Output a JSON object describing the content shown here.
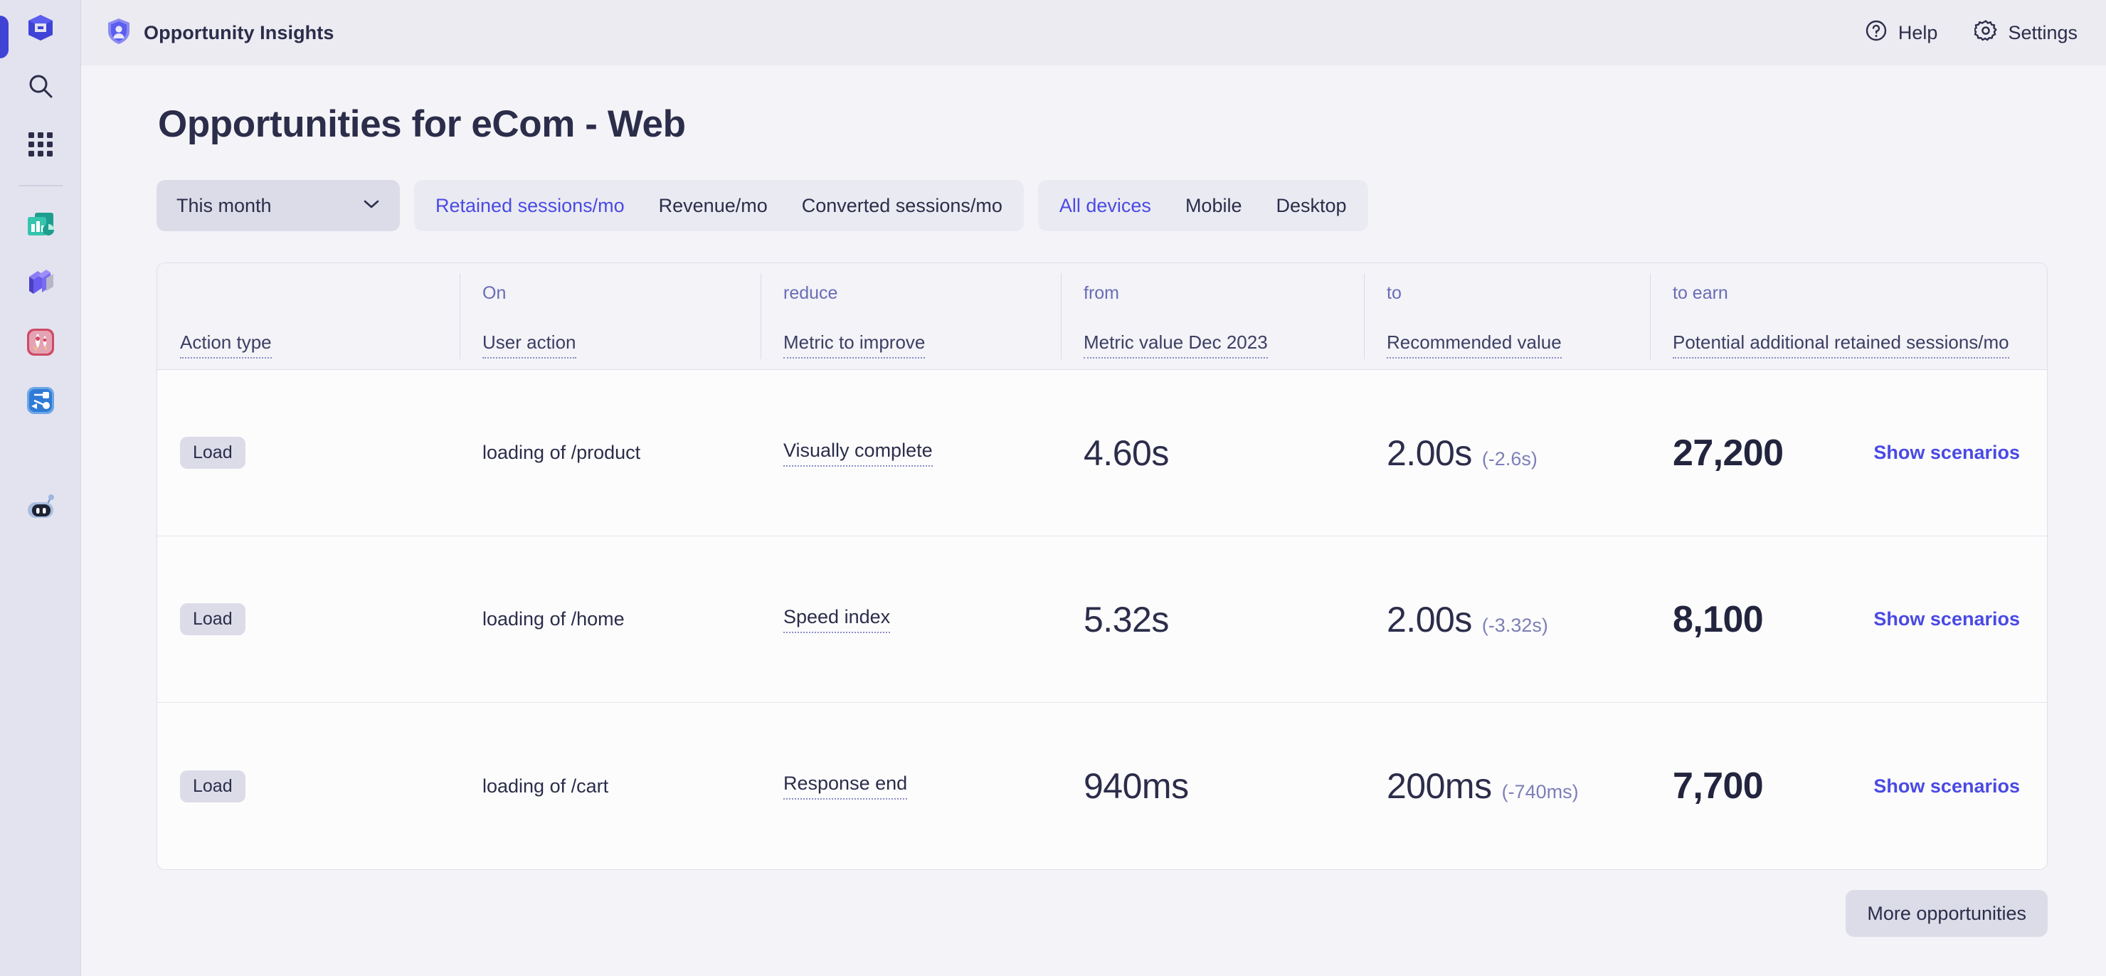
{
  "sidebar": {
    "items": [
      {
        "name": "cube-logo-icon",
        "label": "Home"
      },
      {
        "name": "search-icon",
        "label": "Search"
      },
      {
        "name": "apps-grid-icon",
        "label": "Apps"
      },
      {
        "name": "analytics-chart-icon",
        "label": "Analytics"
      },
      {
        "name": "layers-books-icon",
        "label": "Library"
      },
      {
        "name": "rocket-icon",
        "label": "Launch"
      },
      {
        "name": "flow-diagram-icon",
        "label": "Flows"
      },
      {
        "name": "robot-bot-icon",
        "label": "Assistant"
      }
    ]
  },
  "topbar": {
    "product_icon": "shield-person-icon",
    "product_title": "Opportunity Insights",
    "help_label": "Help",
    "help_icon": "question-circle-icon",
    "settings_label": "Settings",
    "settings_icon": "gear-icon"
  },
  "page": {
    "title": "Opportunities for eCom - Web"
  },
  "filters": {
    "period": {
      "value": "This month",
      "chevron_icon": "chevron-down-icon"
    },
    "metric_tabs": [
      {
        "label": "Retained sessions/mo",
        "active": true
      },
      {
        "label": "Revenue/mo",
        "active": false
      },
      {
        "label": "Converted sessions/mo",
        "active": false
      }
    ],
    "device_tabs": [
      {
        "label": "All devices",
        "active": true
      },
      {
        "label": "Mobile",
        "active": false
      },
      {
        "label": "Desktop",
        "active": false
      }
    ]
  },
  "table": {
    "columns": [
      {
        "top": "",
        "label": "Action type"
      },
      {
        "top": "On",
        "label": "User action"
      },
      {
        "top": "reduce",
        "label": "Metric to improve"
      },
      {
        "top": "from",
        "label": "Metric value Dec 2023"
      },
      {
        "top": "to",
        "label": "Recommended value"
      },
      {
        "top": "to earn",
        "label": "Potential additional retained sessions/mo"
      }
    ],
    "rows": [
      {
        "action_type": "Load",
        "user_action": "loading of /product",
        "metric": "Visually complete",
        "from_value": "4.60s",
        "to_value": "2.00s",
        "delta": "(-2.6s)",
        "earn": "27,200",
        "link": "Show scenarios"
      },
      {
        "action_type": "Load",
        "user_action": "loading of /home",
        "metric": "Speed index",
        "from_value": "5.32s",
        "to_value": "2.00s",
        "delta": "(-3.32s)",
        "earn": "8,100",
        "link": "Show scenarios"
      },
      {
        "action_type": "Load",
        "user_action": "loading of /cart",
        "metric": "Response end",
        "from_value": "940ms",
        "to_value": "200ms",
        "delta": "(-740ms)",
        "earn": "7,700",
        "link": "Show scenarios"
      }
    ]
  },
  "footer": {
    "more_label": "More opportunities"
  },
  "colors": {
    "accent": "#4a4ae4",
    "text": "#2b2d4a",
    "muted": "#6a6cb5",
    "rail_bg": "#e3e3ef",
    "page_bg": "#f4f4f8"
  }
}
